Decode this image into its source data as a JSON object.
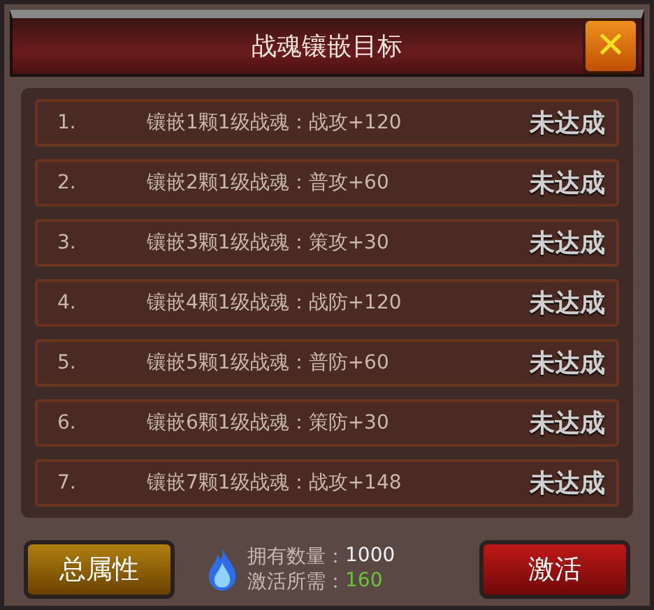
{
  "window": {
    "title": "战魂镶嵌目标",
    "close": "✕"
  },
  "goals": [
    {
      "index": "1.",
      "text": "镶嵌1颗1级战魂：战攻+120",
      "status": "未达成",
      "achieved": false
    },
    {
      "index": "2.",
      "text": "镶嵌2颗1级战魂：普攻+60",
      "status": "未达成",
      "achieved": false
    },
    {
      "index": "3.",
      "text": "镶嵌3颗1级战魂：策攻+30",
      "status": "未达成",
      "achieved": false
    },
    {
      "index": "4.",
      "text": "镶嵌4颗1级战魂：战防+120",
      "status": "未达成",
      "achieved": false
    },
    {
      "index": "5.",
      "text": "镶嵌5颗1级战魂：普防+60",
      "status": "未达成",
      "achieved": false
    },
    {
      "index": "6.",
      "text": "镶嵌6颗1级战魂：策防+30",
      "status": "未达成",
      "achieved": false
    },
    {
      "index": "7.",
      "text": "镶嵌7颗1级战魂：战攻+148",
      "status": "未达成",
      "achieved": false
    }
  ],
  "footer": {
    "attributes_button": "总属性",
    "owned_label": "拥有数量：",
    "owned_value": "1000",
    "required_label": "激活所需：",
    "required_value": "160",
    "activate_button": "激活"
  }
}
